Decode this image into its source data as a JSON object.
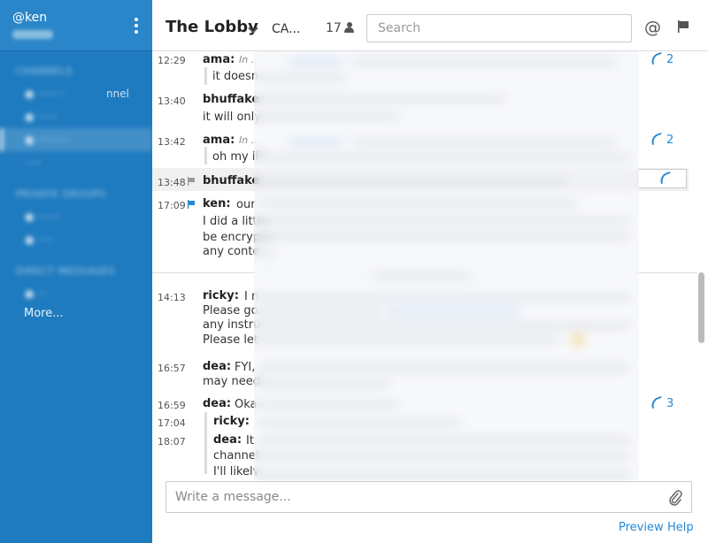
{
  "sidebar": {
    "username": "@ken",
    "sections": [
      {
        "label": "CHANNELS"
      },
      {
        "label": "PRIVATE GROUPS"
      },
      {
        "label": "DIRECT MESSAGES"
      }
    ],
    "channel_fragment": "nnel",
    "more_label": "More..."
  },
  "header": {
    "channel_title": "The Lobby",
    "topic": "CA...",
    "member_count": "17",
    "search_placeholder": "Search"
  },
  "messages": [
    {
      "time": "12:29",
      "user": "ama",
      "text": "In ...",
      "quote": "it doesn",
      "replies": "2"
    },
    {
      "time": "13:40",
      "user": "bhuffake",
      "text": "",
      "body": "it will only"
    },
    {
      "time": "13:42",
      "user": "ama",
      "text": "In ...",
      "quote": "oh my iP",
      "replies": "2"
    },
    {
      "time": "13:48",
      "user": "bhuffake"
    },
    {
      "time": "17:09",
      "user": "ken",
      "text": "our",
      "lines": [
        "I did a little",
        "be encrypte",
        "any conte"
      ]
    },
    {
      "time": "14:13",
      "user": "ricky",
      "text": "I n",
      "lines": [
        "Please go",
        "any instru",
        "Please let"
      ]
    },
    {
      "time": "16:57",
      "user": "dea",
      "text": "FYI,",
      "lines": [
        "may need"
      ]
    },
    {
      "time": "16:59",
      "user": "dea",
      "text": "Oka",
      "replies": "3"
    },
    {
      "time": "17:04",
      "user": "ricky",
      "text": ""
    },
    {
      "time": "18:07",
      "user": "dea",
      "text": "It",
      "lines": [
        "channel",
        "I'll likely"
      ]
    }
  ],
  "composer": {
    "placeholder": "Write a message...",
    "preview_label": "Preview",
    "help_label": "Help"
  },
  "colors": {
    "sidebar": "#1f7bbf",
    "link": "#2389d7"
  }
}
